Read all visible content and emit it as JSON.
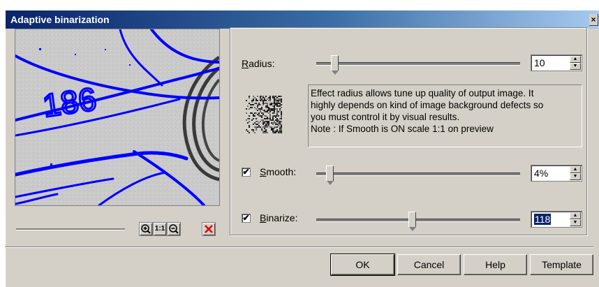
{
  "window": {
    "title": "Adaptive binarization",
    "close_label": "×"
  },
  "preview": {
    "number_text": "186"
  },
  "zoom_tools": [
    {
      "name": "zoom-in-icon"
    },
    {
      "name": "actual-size-icon",
      "label": "1:1"
    },
    {
      "name": "zoom-out-icon"
    },
    {
      "name": "reset-icon"
    }
  ],
  "radius": {
    "label_prefix": "R",
    "label_rest": "adius:",
    "value": "10",
    "slider_position": 0.06
  },
  "description": {
    "lines": [
      "Effect radius allows tune up quality of output image. It",
      "highly depends on kind of image background defects so",
      "you must control it by visual results.",
      "Note : If Smooth is ON scale 1:1 on preview"
    ]
  },
  "smooth": {
    "checked": true,
    "label_prefix": "S",
    "label_rest": "mooth:",
    "value": "4%",
    "slider_position": 0.04
  },
  "binarize": {
    "checked": true,
    "label_prefix": "B",
    "label_rest": "inarize:",
    "value": "118",
    "slider_position": 0.46
  },
  "buttons": {
    "ok": "OK",
    "cancel": "Cancel",
    "help": "Help",
    "template": "Template"
  },
  "colors": {
    "accent": "#0a246a",
    "outline_blue": "#0000ff",
    "face": "#d4d0c8"
  },
  "icons": {
    "checkbox_mark": "✔",
    "spin_up": "▲",
    "spin_down": "▼"
  }
}
